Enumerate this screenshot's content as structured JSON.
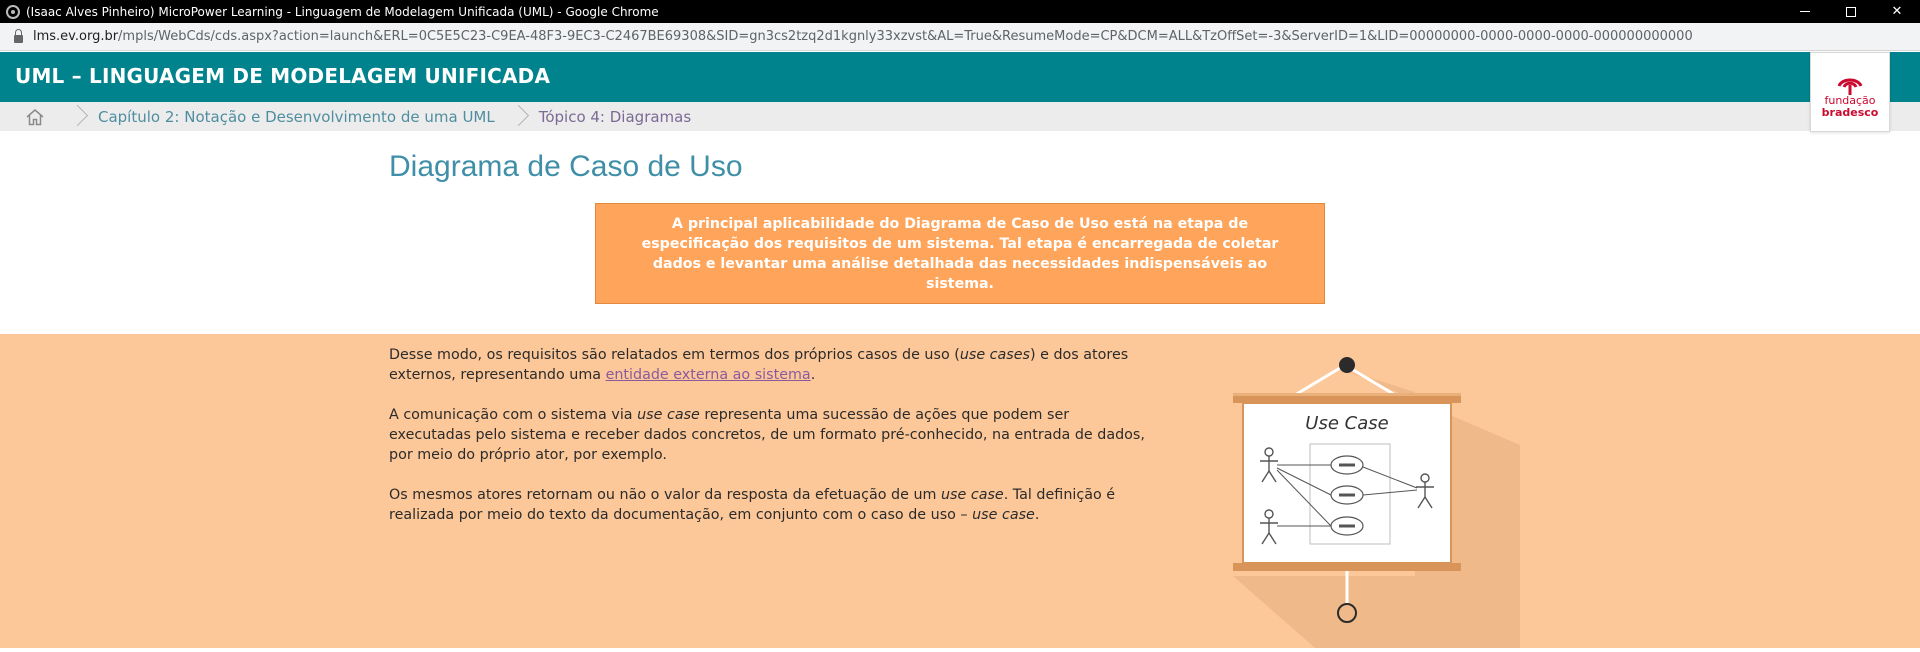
{
  "browser": {
    "window_title": "(Isaac Alves Pinheiro) MicroPower Learning - Linguagem de Modelagem Unificada (UML) - Google Chrome",
    "url_host": "lms.ev.org.br",
    "url_path": "/mpls/WebCds/cds.aspx?action=launch&ERL=0C5E5C23-C9EA-48F3-9EC3-C2467BE69308&SID=gn3cs2tzq2d1kgnly33xzvst&AL=True&ResumeMode=CP&DCM=ALL&TzOffSet=-3&ServerID=1&LID=00000000-0000-0000-0000-000000000000",
    "close_glyph": "✕"
  },
  "header": {
    "course_title": "UML – LINGUAGEM DE MODELAGEM UNIFICADA"
  },
  "breadcrumb": {
    "chapter": "Capítulo 2: Notação e Desenvolvimento de uma UML",
    "topic": "Tópico 4: Diagramas"
  },
  "logo": {
    "line1": "fundação",
    "line2": "bradesco",
    "color": "#cc092f"
  },
  "main": {
    "title": "Diagrama de Caso de Uso",
    "callout": "A principal aplicabilidade do Diagrama de Caso de Uso está na etapa de especificação dos requisitos de um sistema. Tal etapa é encarregada de coletar dados e levantar uma análise detalhada das necessidades indispensáveis ao sistema.",
    "p1_a": "Desse modo, os requisitos são relatados em termos dos próprios casos de uso (",
    "p1_em": "use cases",
    "p1_b": ") e dos atores externos, representando uma ",
    "p1_link": "entidade externa ao sistema",
    "p1_c": ".",
    "p2_a": "A comunicação com o sistema via ",
    "p2_em": "use case",
    "p2_b": " representa uma sucessão de ações que podem ser executadas pelo sistema e receber dados concretos, de um formato pré-conhecido, na entrada de dados, por meio do próprio ator, por exemplo.",
    "p3_a": "Os mesmos atores retornam ou não o valor da resposta da efetuação de um ",
    "p3_em": "use case",
    "p3_b": ". Tal definição é realizada por meio do texto da documentação, em conjunto com o caso de uso – ",
    "p3_em2": "use case",
    "p3_c": "."
  },
  "illustration": {
    "board_title": "Use Case"
  },
  "colors": {
    "teal": "#00838c",
    "callout": "#ffa55b",
    "peach": "#fdc899"
  }
}
